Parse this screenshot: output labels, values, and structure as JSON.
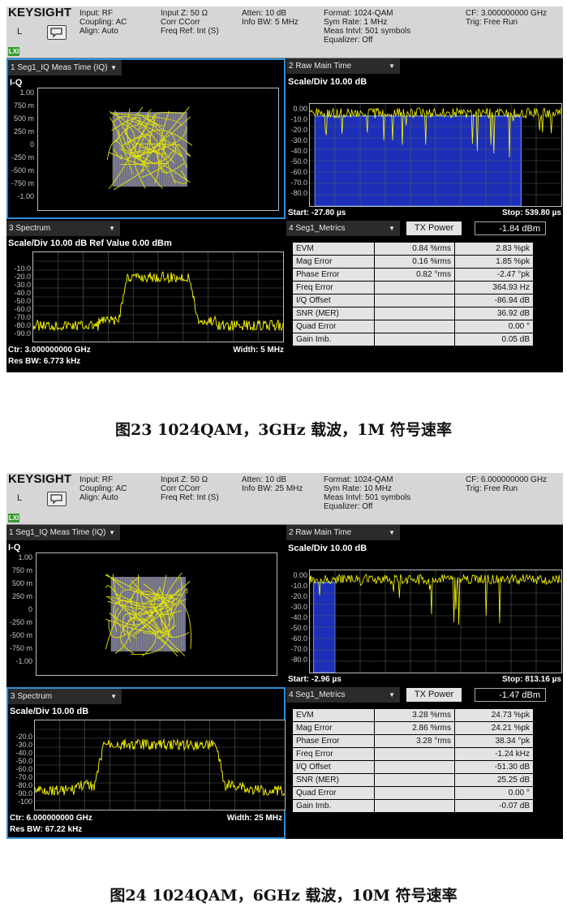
{
  "screens": [
    {
      "header": {
        "brand": "KEYSIGHT",
        "mode_letter": "L",
        "lxi": "LXI",
        "col1": [
          "Input: RF",
          "Coupling: AC",
          "Align: Auto"
        ],
        "col2": [
          "Input Z: 50 Ω",
          "Corr CCorr",
          "Freq Ref: Int (S)"
        ],
        "col3": [
          "Atten: 10 dB",
          "Info BW: 5 MHz"
        ],
        "col4": [
          "Format: 1024-QAM",
          "Sym Rate: 1 MHz",
          "Meas Intvl: 501 symbols",
          "Equalizer: Off"
        ],
        "col5": [
          "CF: 3.000000000 GHz",
          "Trig: Free Run"
        ]
      },
      "pane1": {
        "title": "1 Seg1_IQ Meas Time (IQ)",
        "axis_label": "I-Q",
        "ytick_labels": [
          "1.00",
          "750 m",
          "500 m",
          "250 m",
          "0",
          "-250 m",
          "-500 m",
          "-750 m",
          "-1.00"
        ]
      },
      "pane2": {
        "title": "2 Raw Main Time",
        "scale": "Scale/Div 10.00 dB",
        "ytick_labels": [
          "0.00",
          "-10.0",
          "-20.0",
          "-30.0",
          "-40.0",
          "-50.0",
          "-60.0",
          "-70.0",
          "-80.0"
        ],
        "start": "Start: -27.80 µs",
        "stop": "Stop: 539.80 µs",
        "chart_data": {
          "type": "line",
          "ylim": [
            -90,
            0
          ],
          "ylabel": "dB",
          "gate_window": "blue highlighted region from start to ~84% of span",
          "trace_level_db": -4,
          "color": "#ffff00"
        }
      },
      "pane3": {
        "title": "3 Spectrum",
        "scale": "Scale/Div 10.00 dB Ref Value 0.00 dBm",
        "ytick_labels": [
          "-10.0",
          "-20.0",
          "-30.0",
          "-40.0",
          "-50.0",
          "-60.0",
          "-70.0",
          "-80.0",
          "-90.0"
        ],
        "ctr": "Ctr: 3.000000000 GHz",
        "width": "Width: 5 MHz",
        "resbw": "Res BW: 6.773 kHz",
        "chart_data": {
          "type": "line",
          "ylim": [
            -100,
            0
          ],
          "inband_level_dbm": -25,
          "floor_level_dbm": -83,
          "occupied_fraction": [
            0.38,
            0.62
          ],
          "color": "#ffff00"
        }
      },
      "pane4": {
        "title": "4 Seg1_Metrics",
        "tx_power_label": "TX Power",
        "tx_power_value": "-1.84 dBm",
        "rows": [
          {
            "name": "EVM",
            "v1": "0.84 %rms",
            "v2": "2.83 %pk"
          },
          {
            "name": "Mag Error",
            "v1": "0.16 %rms",
            "v2": "1.85 %pk"
          },
          {
            "name": "Phase Error",
            "v1": "0.82 °rms",
            "v2": "-2.47 °pk"
          },
          {
            "name": "Freq Error",
            "v1": "",
            "v2": "364.93 Hz"
          },
          {
            "name": "I/Q Offset",
            "v1": "",
            "v2": "-86.94 dB"
          },
          {
            "name": "SNR (MER)",
            "v1": "",
            "v2": "36.92 dB"
          },
          {
            "name": "Quad Error",
            "v1": "",
            "v2": "0.00 °"
          },
          {
            "name": "Gain Imb.",
            "v1": "",
            "v2": "0.05 dB"
          }
        ]
      },
      "caption": "图23   1024QAM，3GHz 载波，1M 符号速率"
    },
    {
      "header": {
        "brand": "KEYSIGHT",
        "mode_letter": "L",
        "lxi": "LXI",
        "col1": [
          "Input: RF",
          "Coupling: AC",
          "Align: Auto"
        ],
        "col2": [
          "Input Z: 50 Ω",
          "Corr CCorr",
          "Freq Ref: Int (S)"
        ],
        "col3": [
          "Atten: 10 dB",
          "Info BW: 25 MHz"
        ],
        "col4": [
          "Format: 1024-QAM",
          "Sym Rate: 10 MHz",
          "Meas Intvl: 501 symbols",
          "Equalizer: Off"
        ],
        "col5": [
          "CF: 6.000000000 GHz",
          "Trig: Free Run"
        ]
      },
      "pane1": {
        "title": "1 Seg1_IQ Meas Time (IQ)",
        "axis_label": "I-Q",
        "ytick_labels": [
          "1.00",
          "750 m",
          "500 m",
          "250 m",
          "0",
          "-250 m",
          "-500 m",
          "-750 m",
          "-1.00"
        ]
      },
      "pane2": {
        "title": "2 Raw Main Time",
        "scale": "Scale/Div 10.00 dB",
        "ytick_labels": [
          "0.00",
          "-10.0",
          "-20.0",
          "-30.0",
          "-40.0",
          "-50.0",
          "-60.0",
          "-70.0",
          "-80.0"
        ],
        "start": "Start: -2.96 µs",
        "stop": "Stop: 813.16 µs",
        "chart_data": {
          "type": "line",
          "ylim": [
            -90,
            0
          ],
          "ylabel": "dB",
          "gate_window": "narrow blue highlighted region near start",
          "trace_level_db": -4,
          "color": "#ffff00"
        }
      },
      "pane3": {
        "title": "3 Spectrum",
        "scale": "Scale/Div 10.00 dB",
        "ytick_labels": [
          "-20.0",
          "-30.0",
          "-40.0",
          "-50.0",
          "-60.0",
          "-70.0",
          "-80.0",
          "-90.0",
          "-100"
        ],
        "ctr": "Ctr: 6.000000000 GHz",
        "width": "Width: 25 MHz",
        "resbw": "Res BW: 67.22 kHz",
        "chart_data": {
          "type": "line",
          "ylim": [
            -110,
            -10
          ],
          "inband_level_dbm": -35,
          "floor_level_dbm": -85,
          "occupied_fraction": [
            0.28,
            0.72
          ],
          "color": "#ffff00"
        }
      },
      "pane4": {
        "title": "4 Seg1_Metrics",
        "tx_power_label": "TX Power",
        "tx_power_value": "-1.47 dBm",
        "rows": [
          {
            "name": "EVM",
            "v1": "3.28 %rms",
            "v2": "24.73 %pk"
          },
          {
            "name": "Mag Error",
            "v1": "2.86 %rms",
            "v2": "24.21 %pk"
          },
          {
            "name": "Phase Error",
            "v1": "3.28 °rms",
            "v2": "38.34 °pk"
          },
          {
            "name": "Freq Error",
            "v1": "",
            "v2": "-1.24 kHz"
          },
          {
            "name": "I/Q Offset",
            "v1": "",
            "v2": "-51.30 dB"
          },
          {
            "name": "SNR (MER)",
            "v1": "",
            "v2": "25.25 dB"
          },
          {
            "name": "Quad Error",
            "v1": "",
            "v2": "0.00 °"
          },
          {
            "name": "Gain Imb.",
            "v1": "",
            "v2": "-0.07 dB"
          }
        ]
      },
      "caption": "图24   1024QAM，6GHz 载波，10M 符号速率"
    }
  ]
}
